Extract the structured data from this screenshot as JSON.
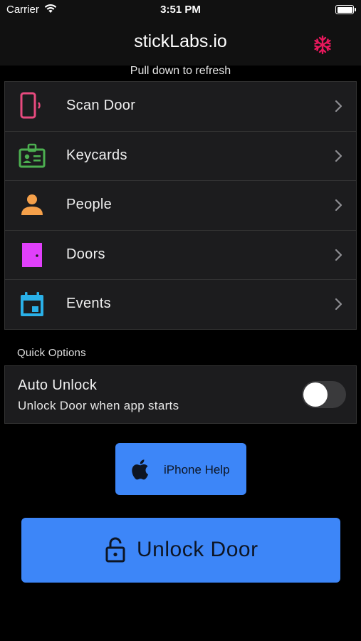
{
  "status_bar": {
    "carrier": "Carrier",
    "time": "3:51 PM"
  },
  "nav": {
    "title": "stickLabs.io",
    "settings_icon": "snowflake-icon",
    "settings_color": "#e8185c"
  },
  "refresh_hint": "Pull down to refresh",
  "menu": {
    "items": [
      {
        "label": "Scan Door",
        "icon": "phone-nfc-icon",
        "color": "#e84a7f"
      },
      {
        "label": "Keycards",
        "icon": "id-card-icon",
        "color": "#4caf50"
      },
      {
        "label": "People",
        "icon": "person-icon",
        "color": "#f5a04a"
      },
      {
        "label": "Doors",
        "icon": "door-icon",
        "color": "#e040fb"
      },
      {
        "label": "Events",
        "icon": "calendar-icon",
        "color": "#2ab0e8"
      }
    ]
  },
  "quick_options": {
    "header": "Quick Options",
    "auto_unlock": {
      "title": "Auto Unlock",
      "subtitle": "Unlock Door when app starts",
      "enabled": false
    }
  },
  "help_button": {
    "label": "iPhone Help",
    "icon": "apple-icon"
  },
  "unlock_button": {
    "label": "Unlock Door",
    "icon": "open-lock-icon"
  },
  "colors": {
    "accent": "#3d86f8",
    "background": "#000000",
    "card": "#1c1c1e"
  }
}
